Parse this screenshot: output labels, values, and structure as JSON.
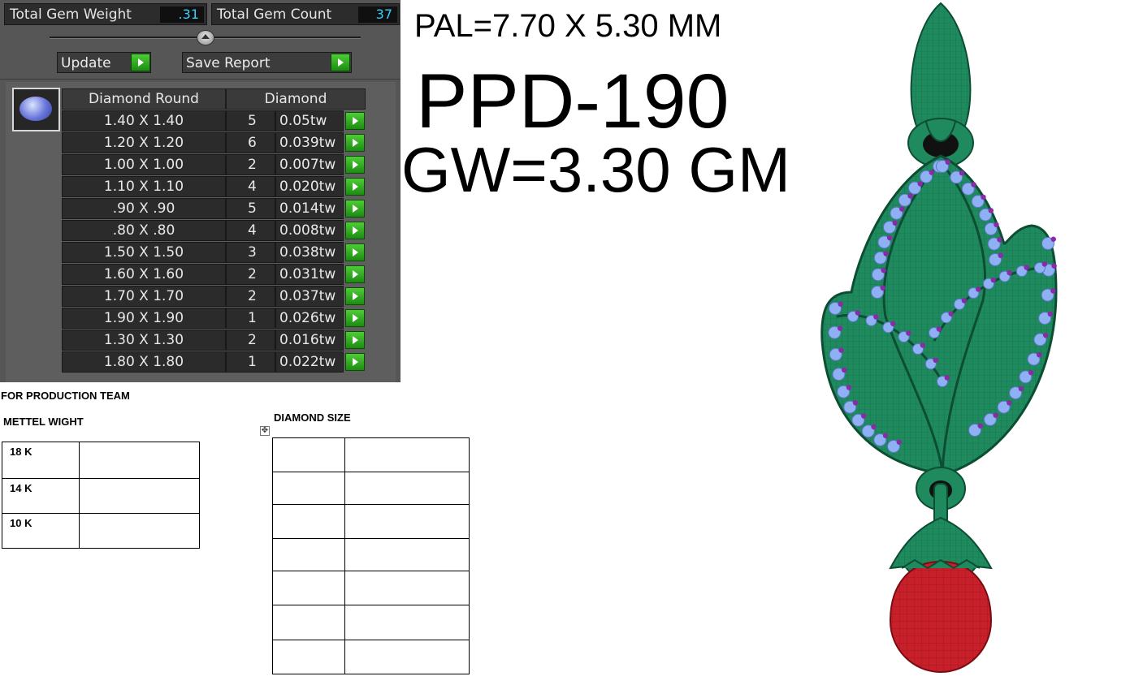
{
  "gem_report": {
    "total_weight_label": "Total Gem Weight",
    "total_weight_value": ".31",
    "total_count_label": "Total Gem Count",
    "total_count_value": "37",
    "update_label": "Update",
    "save_report_label": "Save Report",
    "columns": [
      "Diamond Round",
      "Diamond"
    ],
    "rows": [
      {
        "size": "1.40 X 1.40",
        "count": "5",
        "weight": "0.05tw"
      },
      {
        "size": "1.20 X 1.20",
        "count": "6",
        "weight": "0.039tw"
      },
      {
        "size": "1.00 X 1.00",
        "count": "2",
        "weight": "0.007tw"
      },
      {
        "size": "1.10 X 1.10",
        "count": "4",
        "weight": "0.020tw"
      },
      {
        "size": ".90 X .90",
        "count": "5",
        "weight": "0.014tw"
      },
      {
        "size": ".80 X .80",
        "count": "4",
        "weight": "0.008tw"
      },
      {
        "size": "1.50 X 1.50",
        "count": "3",
        "weight": "0.038tw"
      },
      {
        "size": "1.60 X 1.60",
        "count": "2",
        "weight": "0.031tw"
      },
      {
        "size": "1.70 X 1.70",
        "count": "2",
        "weight": "0.037tw"
      },
      {
        "size": "1.90 X 1.90",
        "count": "1",
        "weight": "0.026tw"
      },
      {
        "size": "1.30 X 1.30",
        "count": "2",
        "weight": "0.016tw"
      },
      {
        "size": "1.80 X 1.80",
        "count": "1",
        "weight": "0.022tw"
      }
    ],
    "gem_icon": "oval-gem-icon",
    "go_icon": "green-arrow-icon"
  },
  "production": {
    "heading": "FOR PRODUCTION TEAM",
    "metal_heading": "METTEL WIGHT",
    "metal_rows": [
      "18 K",
      "14 K",
      "10 K"
    ],
    "diamond_heading": "DIAMOND SIZE",
    "move_icon": "table-move-icon"
  },
  "specs": {
    "pal": "PAL=7.70 X 5.30 MM",
    "design_code": "PPD-190",
    "gross_weight": "GW=3.30 GM"
  },
  "colors": {
    "metal_green": "#1f8a5e",
    "diamond_blue": "#8fb0f2",
    "accent_purple": "#8a2aa8",
    "ruby_red": "#c8202a"
  }
}
